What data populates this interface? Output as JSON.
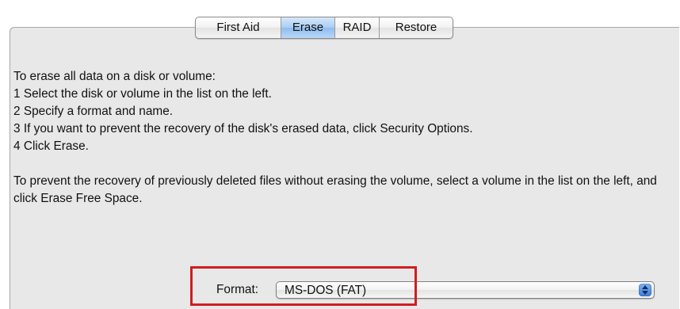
{
  "tabs": [
    "First Aid",
    "Erase",
    "RAID",
    "Restore"
  ],
  "active_tab": "Erase",
  "instructions": {
    "intro": "To erase all data on a disk or volume:",
    "steps": [
      "1 Select the disk or volume in the list on the left.",
      "2 Specify a format and name.",
      "3 If you want to prevent the recovery of the disk's erased data, click Security Options.",
      "4 Click Erase."
    ],
    "free_space_note": "To prevent the recovery of previously deleted files without erasing the volume, select a volume in the list on the left, and click Erase Free Space."
  },
  "format": {
    "label": "Format:",
    "selected_value": "MS-DOS (FAT)"
  },
  "colors": {
    "highlight_box": "#d21d1d",
    "active_tab": "#a9cdf3",
    "panel_background": "#e8e8e8"
  }
}
